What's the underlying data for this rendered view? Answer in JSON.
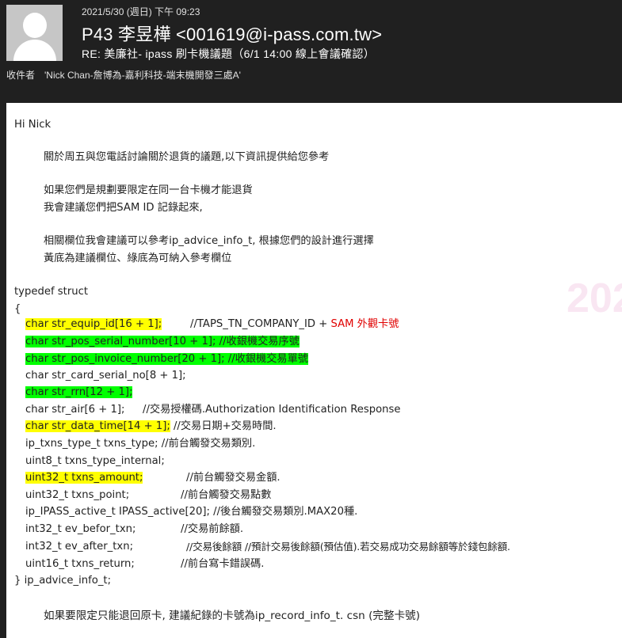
{
  "header": {
    "date": "2021/5/30 (週日) 下午 09:23",
    "from": "P43 李昱樺 <001619@i-pass.com.tw>",
    "subject": "RE: 美廉社- ipass 刷卡機議題（6/1 14:00 線上會議確認）",
    "to_label": "收件者",
    "to_value": "'Nick Chan-詹博為-嘉利科技-端末機開發三處A'"
  },
  "body": {
    "greeting": "Hi Nick",
    "p1": "關於周五與您電話討論關於退貨的議題,以下資訊提供給您參考",
    "p2a": "如果您們是規劃要限定在同一台卡機才能退貨",
    "p2b": "我會建議您們把SAM ID 記錄起來,",
    "p3a": "相關欄位我會建議可以參考ip_advice_info_t, 根據您們的設計進行選擇",
    "p3b": "黃底為建議欄位、綠底為可納入參考欄位",
    "struct_open": "typedef struct",
    "brace_open": "{",
    "code": {
      "l1_hl": "char str_equip_id[16 + 1];",
      "l1_comment": "//TAPS_TN_COMPANY_ID + ",
      "l1_red": "SAM 外觀卡號",
      "l2_hl": "char str_pos_serial_number[10 + 1];  //收銀機交易序號",
      "l3_hl": "char str_pos_invoice_number[20 + 1]; //收銀機交易單號",
      "l4": "char str_card_serial_no[8 + 1];",
      "l5_hl": "char str_rrn[12 + 1];",
      "l6_code": "char str_air[6 + 1];",
      "l6_comment": "//交易授權碼.Authorization Identification Response",
      "l7_hl": "char str_data_time[14 + 1];",
      "l7_comment": " //交易日期+交易時間.",
      "l8": "ip_txns_type_t txns_type;   //前台觸發交易類別.",
      "l9": "uint8_t txns_type_internal;",
      "l10_hl": "uint32_t txns_amount;",
      "l10_comment": "//前台觸發交易金額.",
      "l11_code": "uint32_t txns_point;",
      "l11_comment": "//前台觸發交易點數",
      "l12": "ip_IPASS_active_t IPASS_active[20]; //後台觸發交易類別.MAX20種.",
      "l13_code": "int32_t ev_befor_txn;",
      "l13_comment": "//交易前餘額.",
      "l14_code": "int32_t ev_after_txn;",
      "l14_comment": "//交易後餘額 //預計交易後餘額(預估值).若交易成功交易餘額等於錢包餘額.",
      "l15_code": "uint16_t txns_return;",
      "l15_comment": "//前台寫卡錯誤碼."
    },
    "struct_close": "} ip_advice_info_t;",
    "p4": "如果要限定只能退回原卡, 建議紀錄的卡號為ip_record_info_t. csn (完整卡號)",
    "watermark": "202"
  },
  "colors": {
    "highlight_yellow": "#ffff00",
    "highlight_green": "#00ff00",
    "red_text": "#e00000"
  }
}
